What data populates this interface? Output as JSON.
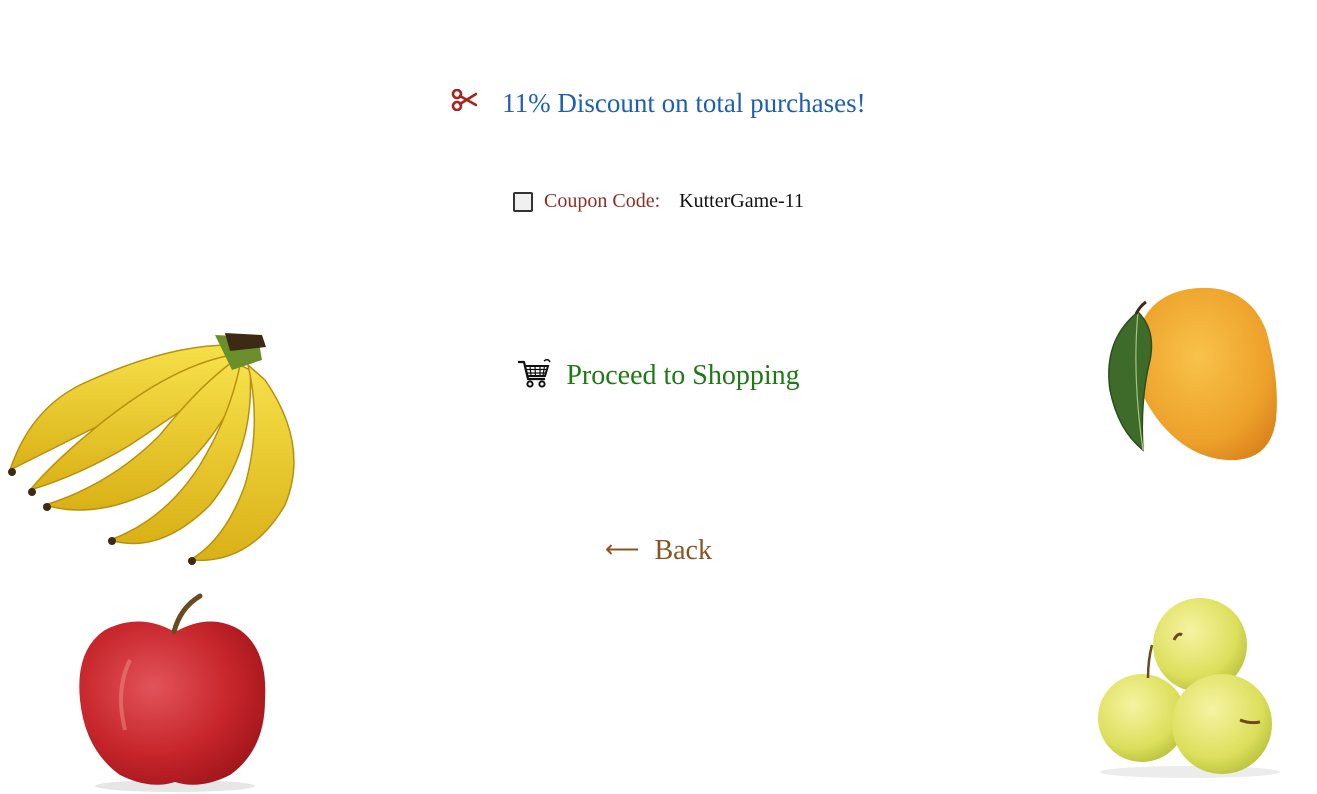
{
  "promo": {
    "icon": "scissors-icon",
    "text": "11% Discount on total purchases!",
    "color": "#1c5fb5"
  },
  "coupon": {
    "checked": false,
    "label": "Coupon Code:",
    "code": "KutterGame-11"
  },
  "actions": {
    "proceed_label": "Proceed to Shopping",
    "proceed_icon": "shopping-cart-icon",
    "back_label": "Back",
    "back_icon": "arrow-left-icon"
  },
  "images": [
    "banana-bunch-image",
    "mango-image",
    "red-apple-image",
    "yellow-apples-image"
  ]
}
